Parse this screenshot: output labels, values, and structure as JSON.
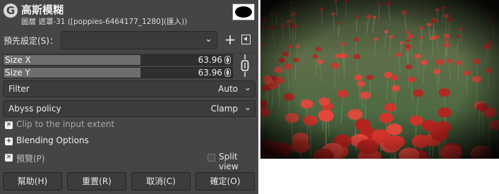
{
  "header": {
    "logo": "G",
    "title": "高斯模糊",
    "subtitle": "圖層 遮罩-31 ([poppies-6464177_1280](匯入))"
  },
  "presets": {
    "label": "預先設定(S)：",
    "value": ""
  },
  "size_x": {
    "label": "Size X",
    "value": "63.96",
    "level": 0.6
  },
  "size_y": {
    "label": "Size Y",
    "value": "63.96",
    "level": 0.6
  },
  "filter": {
    "label": "Filter",
    "value": "Auto"
  },
  "abyss": {
    "label": "Abyss policy",
    "value": "Clamp"
  },
  "options": {
    "clip_label": "Clip to the input extent",
    "blending_label": "Blending Options",
    "preview_label": "預覽(P)",
    "split_label": "Split view"
  },
  "buttons": {
    "help": "幫助(H)",
    "reset": "重置(R)",
    "cancel": "取消(C)",
    "ok": "確定(O)"
  },
  "colors": {
    "dialog_bg": "#454545",
    "poppy_red": "#d6322b"
  }
}
